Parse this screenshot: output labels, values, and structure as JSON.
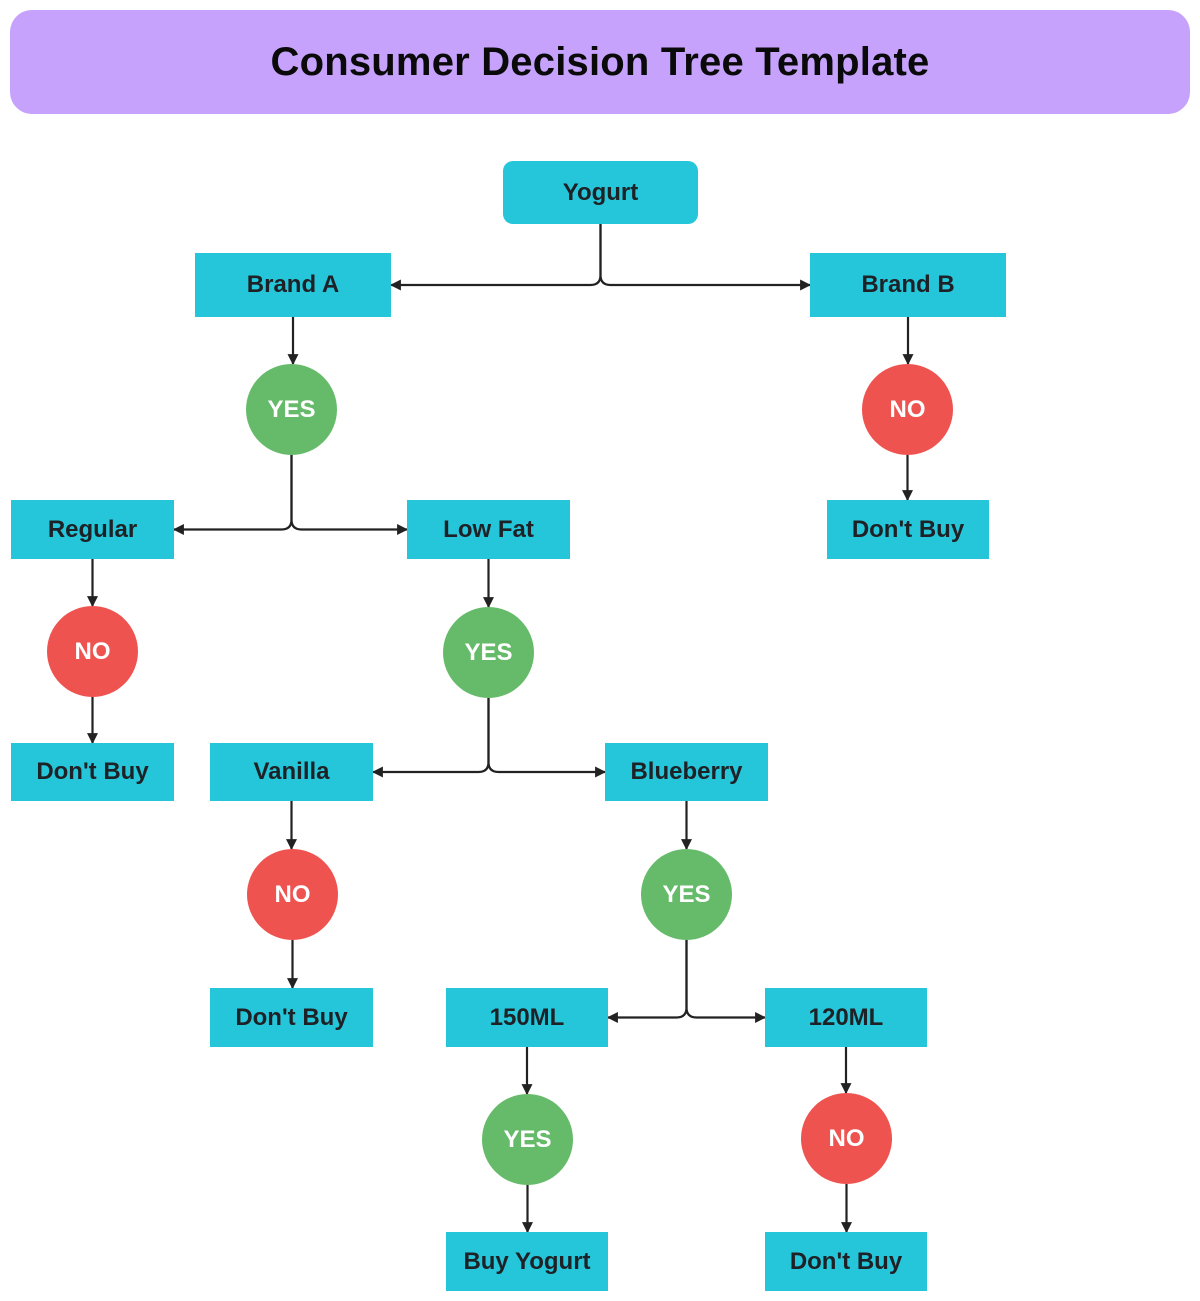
{
  "title": "Consumer Decision Tree Template",
  "colors": {
    "title_bg": "#c6a2fc",
    "box": "#26c6da",
    "yes": "#66bb6a",
    "no": "#ef5350",
    "connector": "#222222"
  },
  "nodes": {
    "yogurt": {
      "label": "Yogurt",
      "kind": "box"
    },
    "brand_a": {
      "label": "Brand A",
      "kind": "box"
    },
    "brand_b": {
      "label": "Brand B",
      "kind": "box"
    },
    "brand_a_yes": {
      "label": "YES",
      "kind": "yes"
    },
    "brand_b_no": {
      "label": "NO",
      "kind": "no"
    },
    "brand_b_dont_buy": {
      "label": "Don't Buy",
      "kind": "box"
    },
    "regular": {
      "label": "Regular",
      "kind": "box"
    },
    "low_fat": {
      "label": "Low Fat",
      "kind": "box"
    },
    "regular_no": {
      "label": "NO",
      "kind": "no"
    },
    "regular_dont_buy": {
      "label": "Don't Buy",
      "kind": "box"
    },
    "low_fat_yes": {
      "label": "YES",
      "kind": "yes"
    },
    "vanilla": {
      "label": "Vanilla",
      "kind": "box"
    },
    "blueberry": {
      "label": "Blueberry",
      "kind": "box"
    },
    "vanilla_no": {
      "label": "NO",
      "kind": "no"
    },
    "vanilla_dont_buy": {
      "label": "Don't Buy",
      "kind": "box"
    },
    "blueberry_yes": {
      "label": "YES",
      "kind": "yes"
    },
    "ml150": {
      "label": "150ML",
      "kind": "box"
    },
    "ml120": {
      "label": "120ML",
      "kind": "box"
    },
    "ml150_yes": {
      "label": "YES",
      "kind": "yes"
    },
    "buy_yogurt": {
      "label": "Buy Yogurt",
      "kind": "box"
    },
    "ml120_no": {
      "label": "NO",
      "kind": "no"
    },
    "ml120_dont_buy": {
      "label": "Don't Buy",
      "kind": "box"
    }
  },
  "edges": [
    {
      "type": "split",
      "from": "yogurt",
      "left": "brand_a",
      "right": "brand_b"
    },
    {
      "type": "down",
      "from": "brand_a",
      "to": "brand_a_yes"
    },
    {
      "type": "down",
      "from": "brand_b",
      "to": "brand_b_no"
    },
    {
      "type": "down",
      "from": "brand_b_no",
      "to": "brand_b_dont_buy"
    },
    {
      "type": "split",
      "from": "brand_a_yes",
      "left": "regular",
      "right": "low_fat"
    },
    {
      "type": "down",
      "from": "regular",
      "to": "regular_no"
    },
    {
      "type": "down",
      "from": "regular_no",
      "to": "regular_dont_buy"
    },
    {
      "type": "down",
      "from": "low_fat",
      "to": "low_fat_yes"
    },
    {
      "type": "split",
      "from": "low_fat_yes",
      "left": "vanilla",
      "right": "blueberry"
    },
    {
      "type": "down",
      "from": "vanilla",
      "to": "vanilla_no"
    },
    {
      "type": "down",
      "from": "vanilla_no",
      "to": "vanilla_dont_buy"
    },
    {
      "type": "down",
      "from": "blueberry",
      "to": "blueberry_yes"
    },
    {
      "type": "split",
      "from": "blueberry_yes",
      "left": "ml150",
      "right": "ml120"
    },
    {
      "type": "down",
      "from": "ml150",
      "to": "ml150_yes"
    },
    {
      "type": "down",
      "from": "ml150_yes",
      "to": "buy_yogurt"
    },
    {
      "type": "down",
      "from": "ml120",
      "to": "ml120_no"
    },
    {
      "type": "down",
      "from": "ml120_no",
      "to": "ml120_dont_buy"
    }
  ]
}
